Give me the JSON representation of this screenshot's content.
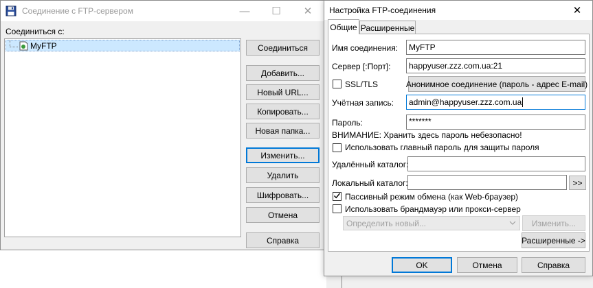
{
  "connect_window": {
    "title": "Соединение с FTP-сервером",
    "close_glyph": "✕",
    "maximize_glyph": "☐",
    "minimize_glyph": "—",
    "connect_to_label": "Соединиться с:",
    "tree_item": "MyFTP",
    "buttons": {
      "connect": "Соединиться",
      "add": "Добавить...",
      "new_url": "Новый URL...",
      "copy": "Копировать...",
      "new_folder": "Новая папка...",
      "edit": "Изменить...",
      "delete": "Удалить",
      "encrypt": "Шифровать...",
      "cancel": "Отмена",
      "help": "Справка"
    }
  },
  "settings_window": {
    "title": "Настройка FTP-соединения",
    "close_glyph": "✕",
    "tabs": [
      "Общие",
      "Расширенные"
    ],
    "fields": {
      "connection_name_label": "Имя соединения:",
      "connection_name_value": "MyFTP",
      "server_label": "Сервер [:Порт]:",
      "server_value": "happyuser.zzz.com.ua:21",
      "ssl_label": "SSL/TLS",
      "anonymous_button": "Анонимное соединение (пароль - адрес E-mail)",
      "account_label": "Учётная запись:",
      "account_value": "admin@happyuser.zzz.com.ua",
      "password_label": "Пароль:",
      "password_value": "*******",
      "warning": "ВНИМАНИЕ: Хранить здесь пароль небезопасно!",
      "master_password_label": "Использовать главный пароль для защиты пароля",
      "remote_dir_label": "Удалённый каталог:",
      "remote_dir_value": "",
      "local_dir_label": "Локальный каталог:",
      "local_dir_value": "",
      "browse_button": ">>",
      "passive_label": "Пассивный режим обмена (как Web-браузер)",
      "firewall_label": "Использовать брандмауэр или прокси-сервер",
      "proxy_select": "Определить новый...",
      "proxy_edit_button": "Изменить...",
      "advanced_button": "Расширенные ->"
    },
    "checkbox_states": {
      "ssl": false,
      "master_password": false,
      "passive": true,
      "firewall": false
    },
    "buttons": {
      "ok": "OK",
      "cancel": "Отмена",
      "help": "Справка"
    }
  },
  "colors": {
    "accent": "#0078d7",
    "tree_selection": "#cce8ff"
  }
}
